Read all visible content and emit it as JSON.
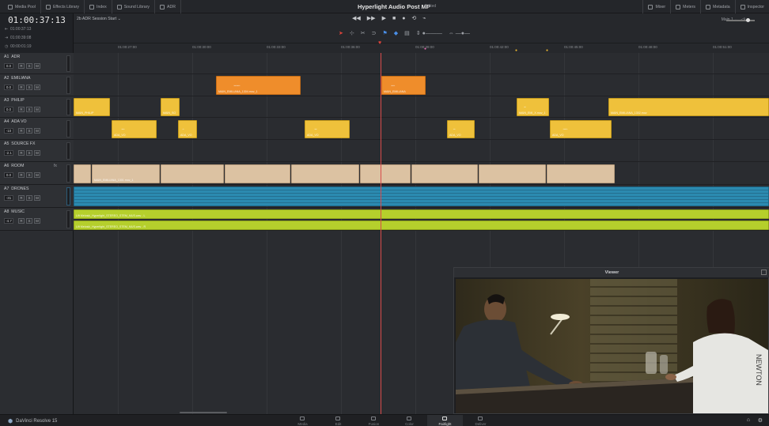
{
  "topbar": {
    "buttons": [
      "Media Pool",
      "Effects Library",
      "Index",
      "Sound Library",
      "ADR"
    ],
    "project_title": "Hyperlight Audio Post MP",
    "project_status": "Edited",
    "right_buttons": [
      "Mixer",
      "Meters",
      "Metadata",
      "Inspector"
    ]
  },
  "timecode": {
    "main": "01:00:37:13",
    "in": "01:00:37:13",
    "out": "01:00:39:08",
    "duration": "00:00:01:19"
  },
  "timeline": {
    "name": "2b ADR Session Start",
    "bus": "Main 1",
    "ruler_labels": [
      "01:00:27:00",
      "01:00:30:00",
      "01:00:33:00",
      "01:00:36:00",
      "01:00:39:00",
      "01:00:42:00",
      "01:00:45:00",
      "01:00:48:00",
      "01:00:51:00"
    ]
  },
  "tracks": [
    {
      "id": "A1",
      "name": "ADR",
      "vol": "0.0"
    },
    {
      "id": "A2",
      "name": "EMILIANA",
      "vol": "0.0"
    },
    {
      "id": "A3",
      "name": "PHILIP",
      "vol": "0.0"
    },
    {
      "id": "A4",
      "name": "ADA VO",
      "vol": "-10"
    },
    {
      "id": "A5",
      "name": "SOURCE FX",
      "vol": "-2.1"
    },
    {
      "id": "A6",
      "name": "ROOM",
      "vol": "0.0",
      "fx": "fx"
    },
    {
      "id": "A7",
      "name": "DRONES",
      "vol": "-31"
    },
    {
      "id": "A8",
      "name": "MUSIC",
      "vol": "-4.7"
    }
  ],
  "track_buttons": [
    "R",
    "S",
    "M"
  ],
  "clips": {
    "a2_1": "MAIN_EMILIANA_1304.mov_1",
    "a2_2": "MAIN_EMILIANA",
    "a3_1": "MAIN_PHILIP",
    "a3_2": "MAIN_SO",
    "a3_3": "MAIN_EMI_X.mov_1",
    "a3_4": "MAIN_EMILIANA_1302.mov",
    "a4_1": "ADA_VO",
    "a4_2": "ADA_VO",
    "a4_3": "ADA_VO",
    "a4_4": "ADA_VO",
    "a4_5": "ADA_VO",
    "a6_1": "MAIN_EMILIANA_1301.mov_1",
    "a7": "",
    "a8_1": "Lift Meloski_Hyperlight_STEREO_STEM_MUS.wav - L",
    "a8_2": "Lift Meloski_Hyperlight_STEREO_STEM_MUS.wav - R"
  },
  "viewer": {
    "title": "Viewer",
    "shirt_text": "NEWTON"
  },
  "bottombar": {
    "brand": "DaVinci Resolve 15",
    "pages": [
      "Media",
      "Edit",
      "Fusion",
      "Color",
      "Fairlight",
      "Deliver"
    ],
    "active_page": "Fairlight"
  }
}
